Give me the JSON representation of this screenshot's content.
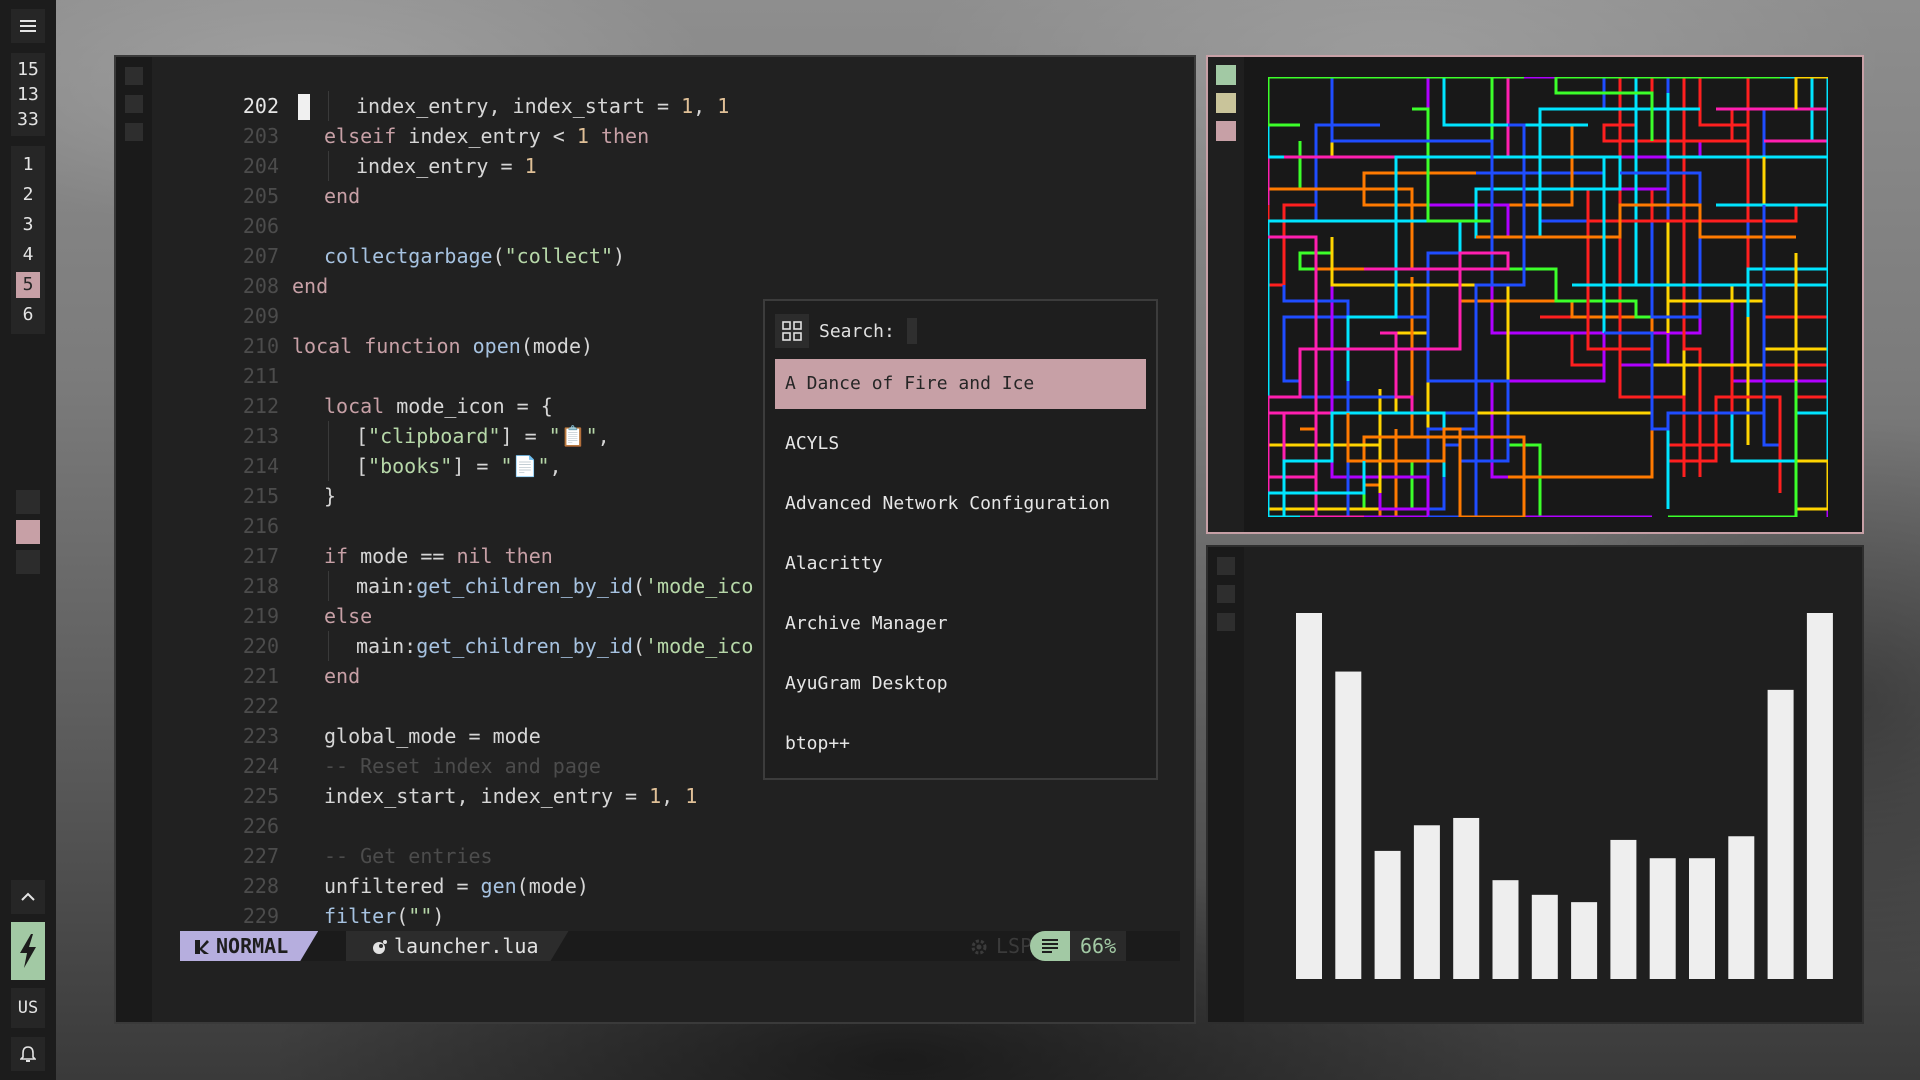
{
  "sidebar": {
    "clock": {
      "hour": "15",
      "minute": "13",
      "second": "33"
    },
    "tags": [
      {
        "label": "1",
        "active": false
      },
      {
        "label": "2",
        "active": false
      },
      {
        "label": "3",
        "active": false
      },
      {
        "label": "4",
        "active": false
      },
      {
        "label": "5",
        "active": true
      },
      {
        "label": "6",
        "active": false
      }
    ],
    "keyboard_layout": "US",
    "icons": {
      "menu": "menu-icon",
      "up": "chevron-up-icon",
      "power": "lightning-icon",
      "bell": "bell-icon"
    }
  },
  "editor": {
    "lines": [
      {
        "num": "202",
        "text": "index_entry, index_start = 1, 1",
        "current": true,
        "indent": 2
      },
      {
        "num": "203",
        "text": "elseif index_entry < 1 then",
        "indent": 1
      },
      {
        "num": "204",
        "text": "index_entry = 1",
        "indent": 2
      },
      {
        "num": "205",
        "text": "end",
        "indent": 1
      },
      {
        "num": "206",
        "text": "",
        "indent": 0
      },
      {
        "num": "207",
        "text": "collectgarbage(\"collect\")",
        "indent": 1
      },
      {
        "num": "208",
        "text": "end",
        "indent": 0
      },
      {
        "num": "209",
        "text": "",
        "indent": 0
      },
      {
        "num": "210",
        "text": "local function open(mode)",
        "indent": 0
      },
      {
        "num": "211",
        "text": "",
        "indent": 0
      },
      {
        "num": "212",
        "text": "local mode_icon = {",
        "indent": 1
      },
      {
        "num": "213",
        "text": "[\"clipboard\"] = \"📋\",",
        "indent": 2
      },
      {
        "num": "214",
        "text": "[\"books\"] = \"📄\",",
        "indent": 2
      },
      {
        "num": "215",
        "text": "}",
        "indent": 1
      },
      {
        "num": "216",
        "text": "",
        "indent": 0
      },
      {
        "num": "217",
        "text": "if mode == nil then",
        "indent": 1
      },
      {
        "num": "218",
        "text": "main:get_children_by_id('mode_ico",
        "indent": 2
      },
      {
        "num": "219",
        "text": "else",
        "indent": 1
      },
      {
        "num": "220",
        "text": "main:get_children_by_id('mode_ico",
        "indent": 2
      },
      {
        "num": "221",
        "text": "end",
        "indent": 1
      },
      {
        "num": "222",
        "text": "",
        "indent": 0
      },
      {
        "num": "223",
        "text": "global_mode = mode",
        "indent": 1
      },
      {
        "num": "224",
        "text": "-- Reset index and page",
        "indent": 1,
        "comment": true
      },
      {
        "num": "225",
        "text": "index_start, index_entry = 1, 1",
        "indent": 1
      },
      {
        "num": "226",
        "text": "",
        "indent": 0
      },
      {
        "num": "227",
        "text": "-- Get entries",
        "indent": 1,
        "comment": true
      },
      {
        "num": "228",
        "text": "unfiltered = gen(mode)",
        "indent": 1
      },
      {
        "num": "229",
        "text": "filter(\"\")",
        "indent": 1
      }
    ],
    "statusline": {
      "mode": "NORMAL",
      "filename": "launcher.lua",
      "lsp": "LSP",
      "percent": "66%"
    }
  },
  "launcher": {
    "search_label": "Search:",
    "search_value": "",
    "items": [
      {
        "label": "A Dance of Fire and Ice",
        "selected": true
      },
      {
        "label": "ACYLS"
      },
      {
        "label": "Advanced Network Configuration"
      },
      {
        "label": "Alacritty"
      },
      {
        "label": "Archive Manager"
      },
      {
        "label": "AyuGram Desktop"
      },
      {
        "label": "btop++"
      }
    ]
  },
  "visualizer": {
    "levels": [
      1.0,
      0.84,
      0.35,
      0.42,
      0.44,
      0.27,
      0.23,
      0.21,
      0.38,
      0.33,
      0.33,
      0.39,
      0.79,
      1.0
    ]
  },
  "colors": {
    "accent_pink": "#c7a0a6",
    "accent_green": "#a2c9a4",
    "mode_purple": "#b6aede",
    "keyword": "#c7a0a6",
    "number": "#e0c097",
    "string": "#b6d7a8",
    "func": "#a6c2e0"
  }
}
